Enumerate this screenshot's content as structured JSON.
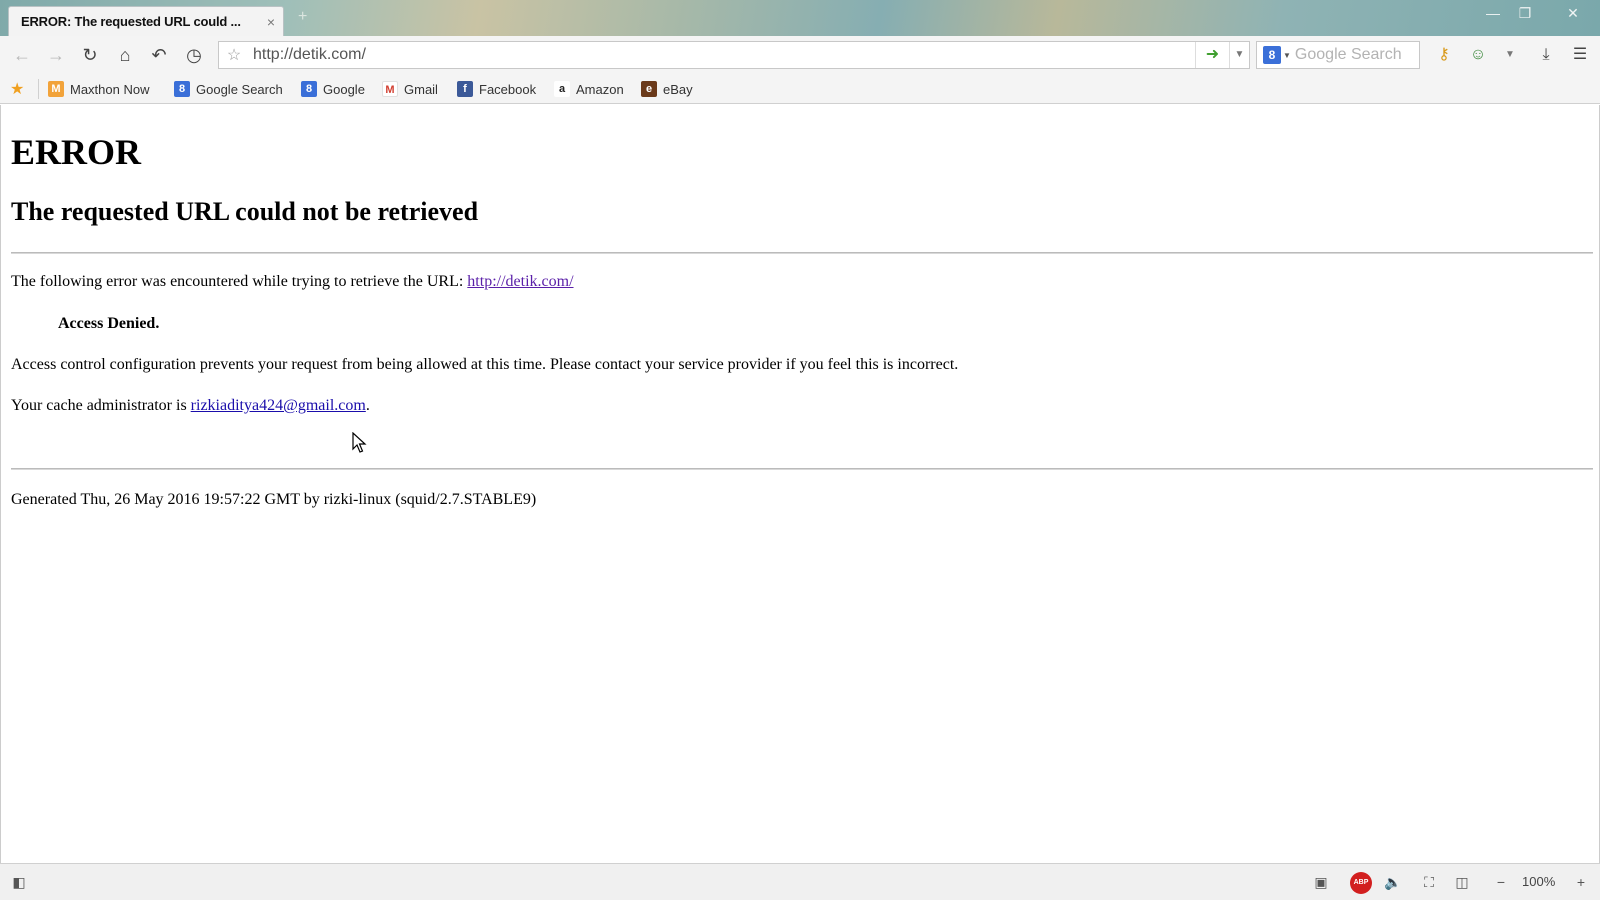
{
  "browser": {
    "tab_title": "ERROR: The requested URL could ...",
    "tab_close": "×",
    "new_tab": "+",
    "window_controls": {
      "minimize": "—",
      "restore": "❐",
      "close": "✕"
    },
    "address": "http://detik.com/",
    "search_placeholder": "Google Search",
    "search_engine_letter": "8",
    "icons": [
      "back-icon",
      "forward-icon",
      "reload-icon",
      "home-icon",
      "undo-icon",
      "history-icon",
      "star-icon",
      "go-icon",
      "dropdown-icon",
      "key-icon",
      "user-icon",
      "download-icon",
      "menu-icon"
    ]
  },
  "bookmarks": [
    {
      "label": "Maxthon Now",
      "icon_char": "M",
      "color": "#f2a33a"
    },
    {
      "label": "Google Search",
      "icon_char": "8",
      "color": "#3a6fd8"
    },
    {
      "label": "Google",
      "icon_char": "8",
      "color": "#3a6fd8"
    },
    {
      "label": "Gmail",
      "icon_char": "M",
      "color": "#ffffff"
    },
    {
      "label": "Facebook",
      "icon_char": "f",
      "color": "#3b5998"
    },
    {
      "label": "Amazon",
      "icon_char": "a",
      "color": "#ffffff"
    },
    {
      "label": "eBay",
      "icon_char": "e",
      "color": "#6b3a1a"
    }
  ],
  "page": {
    "heading": "ERROR",
    "subheading": "The requested URL could not be retrieved",
    "error_intro": "The following error was encountered while trying to retrieve the URL: ",
    "error_url": "http://detik.com/",
    "denied": "Access Denied.",
    "denied_detail": "Access control configuration prevents your request from being allowed at this time. Please contact your service provider if you feel this is incorrect.",
    "admin_intro": "Your cache administrator is ",
    "admin_email": "rizkiaditya424@gmail.com",
    "admin_end": ".",
    "generated": "Generated Thu, 26 May 2016 19:57:22 GMT by rizki-linux (squid/2.7.STABLE9)"
  },
  "statusbar": {
    "zoom": "100%",
    "zoom_out": "−",
    "zoom_in": "+",
    "adblock": "ABP"
  }
}
